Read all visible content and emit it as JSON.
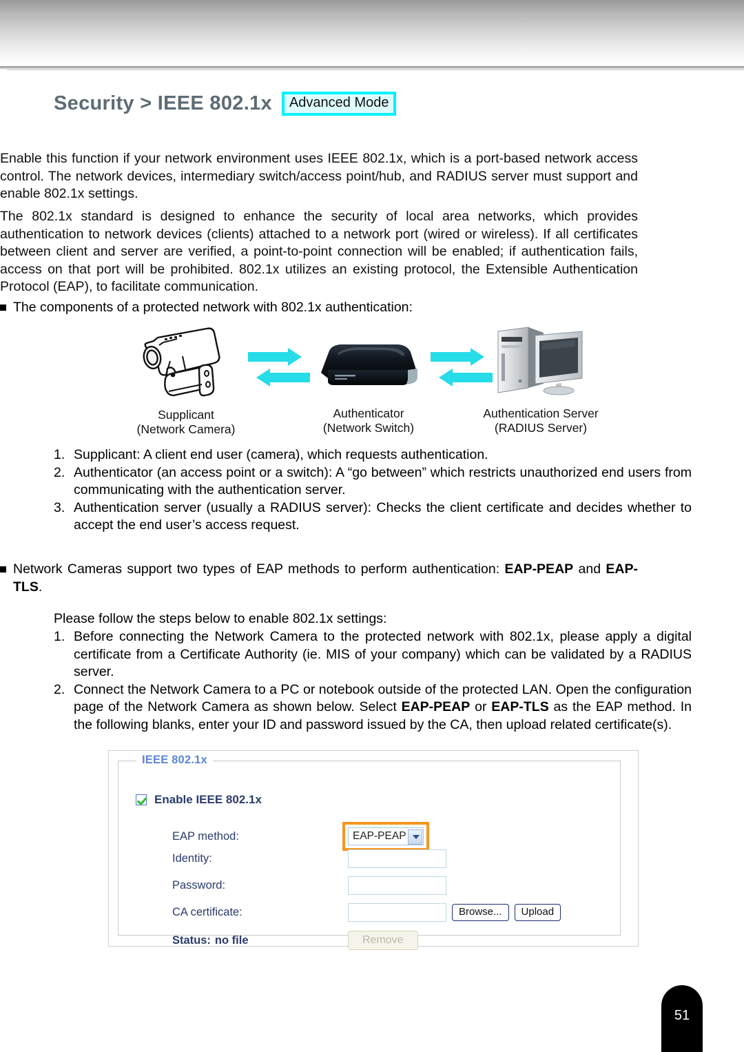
{
  "header": {
    "title": "Security >  IEEE 802.1x",
    "mode_badge": "Advanced Mode"
  },
  "paragraphs": {
    "p1": "Enable this function if your network environment uses IEEE 802.1x, which is a port-based network access control. The network devices, intermediary switch/access point/hub, and RADIUS server must support and enable 802.1x settings.",
    "p2": "The 802.1x standard is designed to enhance the security of local area networks, which provides authentication to network devices (clients) attached to a network port (wired or wireless). If all certificates between client and server are verified, a point-to-point connection will be enabled; if authentication fails, access on that port will be prohibited. 802.1x utilizes an existing protocol, the Extensible Authentication Protocol (EAP), to facilitate communication.",
    "bullet1": "The components of a protected network with 802.1x authentication:",
    "intro_steps": "Please follow the steps below to enable 802.1x settings:"
  },
  "bullet2": {
    "prefix": "Network Cameras support two types of EAP methods to perform authentication: ",
    "bold1": "EAP-PEAP",
    "mid": " and ",
    "bold2": "EAP-TLS",
    "suffix": "."
  },
  "diagram": {
    "nodes": [
      {
        "icon": "network-camera-icon",
        "label": "Supplicant",
        "sublabel": "(Network Camera)"
      },
      {
        "icon": "network-switch-icon",
        "label": "Authenticator",
        "sublabel": "(Network Switch)"
      },
      {
        "icon": "radius-server-icon",
        "label": "Authentication Server",
        "sublabel": "(RADIUS Server)"
      }
    ],
    "arrow_color": "#25dce8"
  },
  "components_list": [
    {
      "n": "1.",
      "text": "Supplicant: A client end user (camera), which requests authentication."
    },
    {
      "n": "2.",
      "text": "Authenticator (an access point or a switch): A “go between” which restricts unauthorized end users from communicating with the authentication server."
    },
    {
      "n": "3.",
      "text": "Authentication server (usually a RADIUS server): Checks the client certificate and decides whether to accept the end user’s access request."
    }
  ],
  "steps_list": [
    {
      "n": "1.",
      "text": "Before connecting the Network Camera to the protected network with 802.1x, please apply a digital certificate from a Certificate Authority (ie. MIS of your company) which can be validated by a RADIUS server."
    },
    {
      "n": "2.",
      "segments": [
        {
          "t": "Connect the Network Camera to a PC or notebook outside of the protected LAN. Open the configuration page of the Network Camera as shown below. Select ",
          "bold": false
        },
        {
          "t": "EAP-PEAP",
          "bold": true
        },
        {
          "t": " or ",
          "bold": false
        },
        {
          "t": "EAP-TLS",
          "bold": true
        },
        {
          "t": " as the EAP method. In the following blanks, enter your ID and password issued by the CA, then upload related certificate(s).",
          "bold": false
        }
      ]
    }
  ],
  "config_panel": {
    "legend": "IEEE 802.1x",
    "enable_checkbox_label": "Enable IEEE 802.1x",
    "enable_checked": true,
    "rows": {
      "eap_method_label": "EAP method:",
      "eap_method_value": "EAP-PEAP",
      "identity_label": "Identity:",
      "identity_value": "",
      "password_label": "Password:",
      "password_value": "",
      "ca_certificate_label": "CA certificate:",
      "ca_certificate_value": "",
      "browse_button": "Browse...",
      "upload_button": "Upload",
      "status_label": "Status:",
      "status_value": "no file",
      "remove_button": "Remove"
    },
    "highlight_color": "#f79521",
    "legend_color": "#5b86d8",
    "label_color": "#2b3c6b"
  },
  "footer": {
    "page_number": "51"
  }
}
